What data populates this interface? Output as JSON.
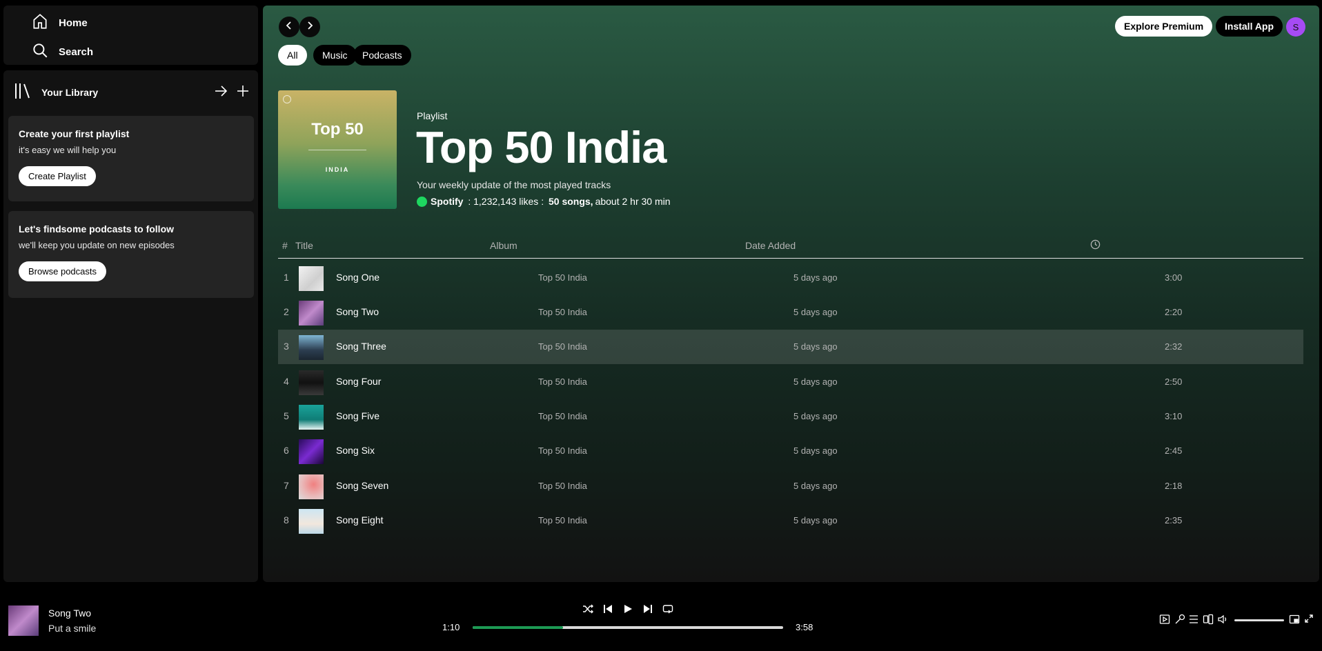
{
  "sidebar": {
    "home_label": "Home",
    "search_label": "Search",
    "library_label": "Your Library",
    "playlist_card": {
      "title": "Create your first playlist",
      "text": "it's easy we will help you",
      "button": "Create Playlist"
    },
    "podcast_card": {
      "title": "Let's findsome podcasts to follow",
      "text": "we'll keep you update on new episodes",
      "button": "Browse podcasts"
    }
  },
  "header": {
    "chips": [
      "All",
      "Music",
      "Podcasts"
    ],
    "explore_premium": "Explore Premium",
    "install_app": "Install App",
    "avatar_letter": "S"
  },
  "playlist": {
    "cover_title": "Top 50",
    "cover_sub": "INDIA",
    "type": "Playlist",
    "title": "Top 50 India",
    "description": "Your weekly update of the most played tracks",
    "owner": "Spotify",
    "likes": " : 1,232,143 likes : ",
    "songs": "50 songs,",
    "duration": "about 2 hr 30 min"
  },
  "table": {
    "headers": {
      "num": "#",
      "title": "Title",
      "album": "Album",
      "date": "Date Added"
    },
    "rows": [
      {
        "num": "1",
        "title": "Song One",
        "album": "Top 50 India",
        "date": "5 days ago",
        "duration": "3:00"
      },
      {
        "num": "2",
        "title": "Song Two",
        "album": "Top 50 India",
        "date": "5 days ago",
        "duration": "2:20"
      },
      {
        "num": "3",
        "title": "Song Three",
        "album": "Top 50 India",
        "date": "5 days ago",
        "duration": "2:32"
      },
      {
        "num": "4",
        "title": "Song Four",
        "album": "Top 50 India",
        "date": "5 days ago",
        "duration": "2:50"
      },
      {
        "num": "5",
        "title": "Song Five",
        "album": "Top 50 India",
        "date": "5 days ago",
        "duration": "3:10"
      },
      {
        "num": "6",
        "title": "Song Six",
        "album": "Top 50 India",
        "date": "5 days ago",
        "duration": "2:45"
      },
      {
        "num": "7",
        "title": "Song Seven",
        "album": "Top 50 India",
        "date": "5 days ago",
        "duration": "2:18"
      },
      {
        "num": "8",
        "title": "Song Eight",
        "album": "Top 50 India",
        "date": "5 days ago",
        "duration": "2:35"
      }
    ]
  },
  "player": {
    "title": "Song Two",
    "artist": "Put a smile",
    "elapsed": "1:10",
    "total": "3:58",
    "progress_fraction": 0.29,
    "accent_color": "#1d9a54"
  }
}
